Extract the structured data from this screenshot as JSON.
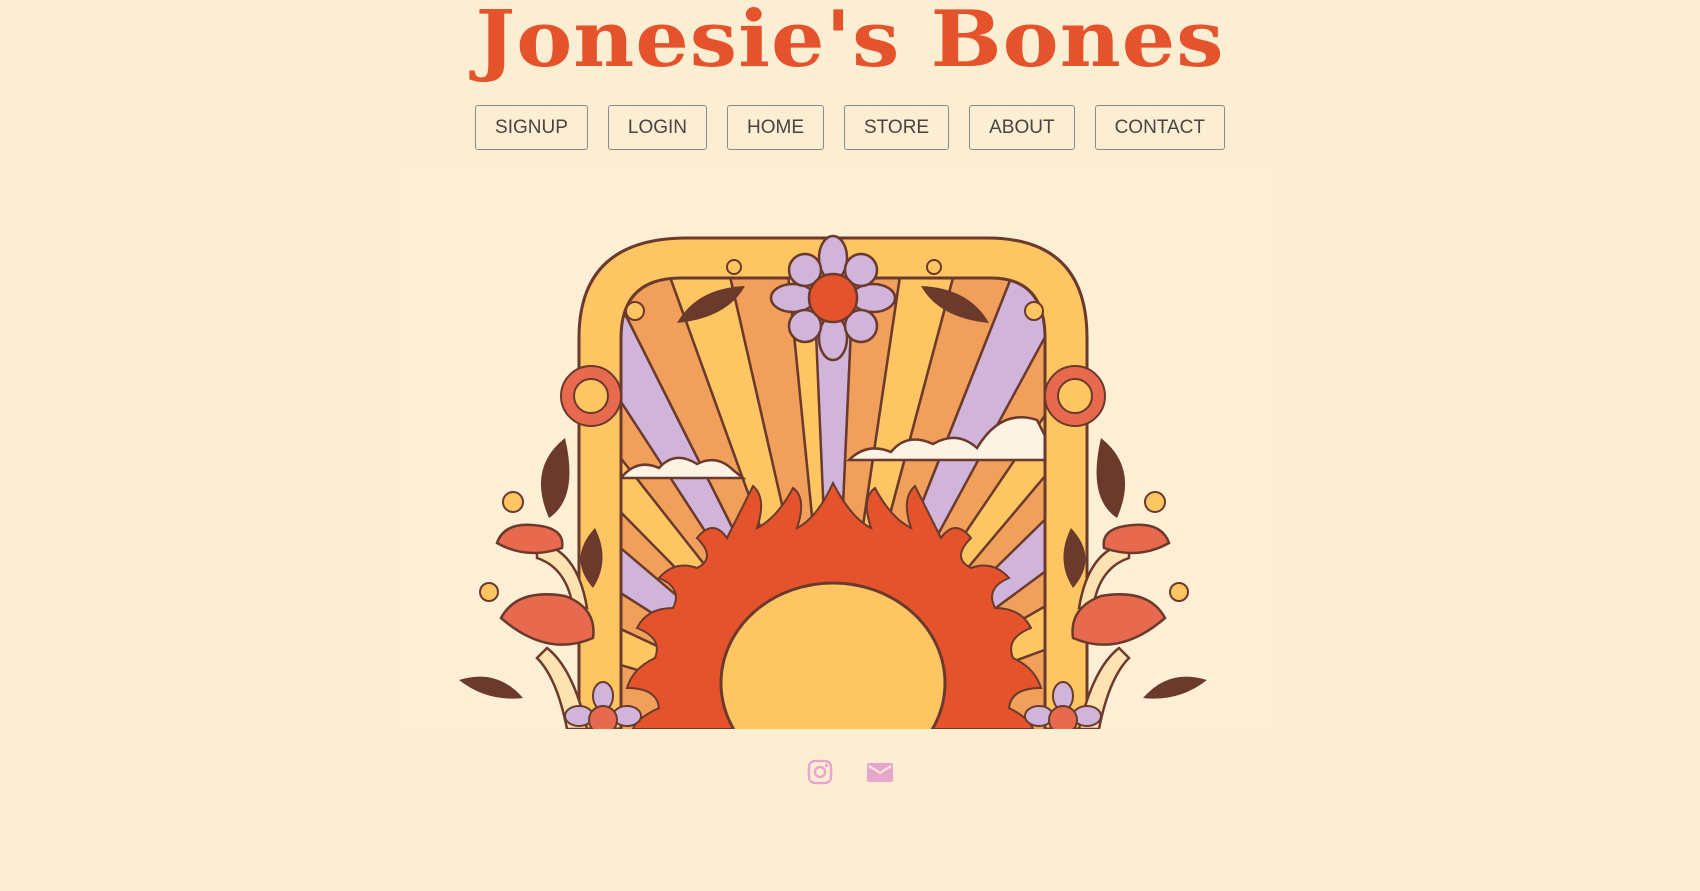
{
  "header": {
    "title": "Jonesie's Bones"
  },
  "nav": {
    "items": [
      {
        "label": "SIGNUP"
      },
      {
        "label": "LOGIN"
      },
      {
        "label": "HOME"
      },
      {
        "label": "STORE"
      },
      {
        "label": "ABOUT"
      },
      {
        "label": "CONTACT"
      }
    ]
  },
  "hero": {
    "image": "retro-sun-arch-illustration"
  },
  "social": {
    "icons": [
      "instagram-icon",
      "mail-icon"
    ],
    "icon_color": "#e8a6cf"
  },
  "colors": {
    "background": "#fbeed3",
    "title": "#e4532b",
    "hero_background": "#fdeed6"
  }
}
